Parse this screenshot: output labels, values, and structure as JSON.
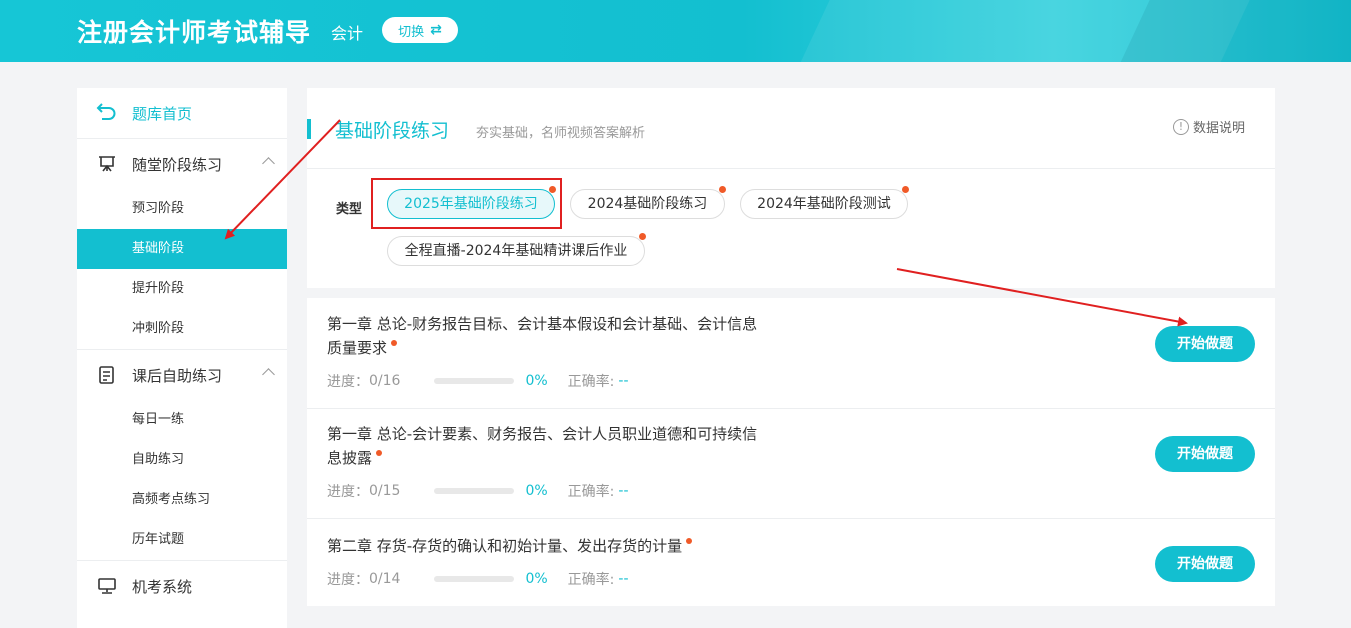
{
  "header": {
    "brand": "注册会计师考试辅导",
    "subject": "会计",
    "switch_label": "切换",
    "switch_arrow": "⇄"
  },
  "sidebar": {
    "home": {
      "label": "题库首页",
      "icon": "back-arrow-icon"
    },
    "groups": [
      {
        "label": "随堂阶段练习",
        "icon": "easel-icon",
        "items": [
          "预习阶段",
          "基础阶段",
          "提升阶段",
          "冲刺阶段"
        ]
      },
      {
        "label": "课后自助练习",
        "icon": "clipboard-icon",
        "items": [
          "每日一练",
          "自助练习",
          "高频考点练习",
          "历年试题"
        ]
      },
      {
        "label": "机考系统",
        "icon": "monitor-icon",
        "items": []
      }
    ],
    "active_item": "基础阶段"
  },
  "section": {
    "title": "基础阶段练习",
    "subtitle": "夯实基础，名师视频答案解析",
    "help_label": "数据说明",
    "help_icon": "!"
  },
  "types": {
    "label": "类型",
    "options": [
      "2025年基础阶段练习",
      "2024基础阶段练习",
      "2024年基础阶段测试",
      "全程直播-2024年基础精讲课后作业"
    ],
    "selected": "2025年基础阶段练习"
  },
  "list": {
    "progress_label": "进度：",
    "accuracy_label": "正确率:",
    "start_label": "开始做题",
    "rows": [
      {
        "title": "第一章 总论-财务报告目标、会计基本假设和会计基础、会计信息质量要求",
        "progress": "0/16",
        "percent": "0%",
        "accuracy": "--"
      },
      {
        "title": "第一章 总论-会计要素、财务报告、会计人员职业道德和可持续信息披露",
        "progress": "0/15",
        "percent": "0%",
        "accuracy": "--"
      },
      {
        "title": "第二章 存货-存货的确认和初始计量、发出存货的计量",
        "progress": "0/14",
        "percent": "0%",
        "accuracy": "--"
      }
    ]
  },
  "colors": {
    "accent": "#13bfd0",
    "dot": "#f05a28",
    "annotation": "#e02020"
  }
}
